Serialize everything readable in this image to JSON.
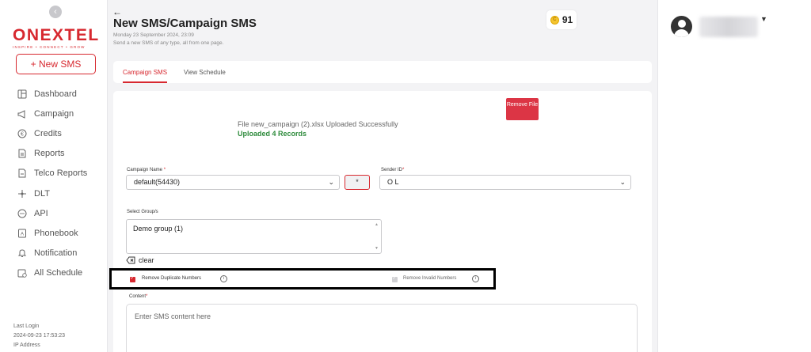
{
  "sidebar": {
    "logo_text": "ONEXTEL",
    "logo_tagline": "INSPIRE • CONNECT • GROW",
    "new_sms_label": "+ New SMS",
    "items": [
      {
        "label": "Dashboard",
        "icon": "dashboard-icon"
      },
      {
        "label": "Campaign",
        "icon": "megaphone-icon"
      },
      {
        "label": "Credits",
        "icon": "credits-icon"
      },
      {
        "label": "Reports",
        "icon": "reports-icon"
      },
      {
        "label": "Telco Reports",
        "icon": "telco-reports-icon"
      },
      {
        "label": "DLT",
        "icon": "dlt-icon"
      },
      {
        "label": "API",
        "icon": "api-icon"
      },
      {
        "label": "Phonebook",
        "icon": "phonebook-icon"
      },
      {
        "label": "Notification",
        "icon": "bell-icon"
      },
      {
        "label": "All Schedule",
        "icon": "schedule-icon"
      }
    ],
    "last_login_label": "Last Login",
    "last_login_value": "2024-09-23 17:53:23",
    "ip_label": "IP Address"
  },
  "header": {
    "title": "New SMS/Campaign SMS",
    "date": "Monday 23 September 2024, 23:09",
    "subtitle": "Send a new SMS of any type, all from one page.",
    "credits": "91"
  },
  "tabs": [
    {
      "label": "Campaign SMS",
      "active": true
    },
    {
      "label": "View Schedule",
      "active": false
    }
  ],
  "upload": {
    "remove_file_label": "Remove File",
    "message": "File new_campaign (2).xlsx Uploaded Successfully",
    "count": "Uploaded 4 Records"
  },
  "form": {
    "campaign_name_label": "Campaign Name",
    "campaign_name_value": "default(54430)",
    "star_button": "*",
    "sender_id_label": "Sender ID",
    "sender_id_value": "O     L",
    "group_label": "Select Group/s",
    "group_value": "Demo group (1)",
    "clear_label": "clear",
    "remove_duplicates_label": "Remove Duplicate Numbers",
    "remove_invalid_label": "Remove Invalid Numbers",
    "content_label": "Content",
    "content_placeholder": "Enter SMS content here"
  },
  "colors": {
    "accent": "#d7282f",
    "success": "#2e8b3c"
  }
}
